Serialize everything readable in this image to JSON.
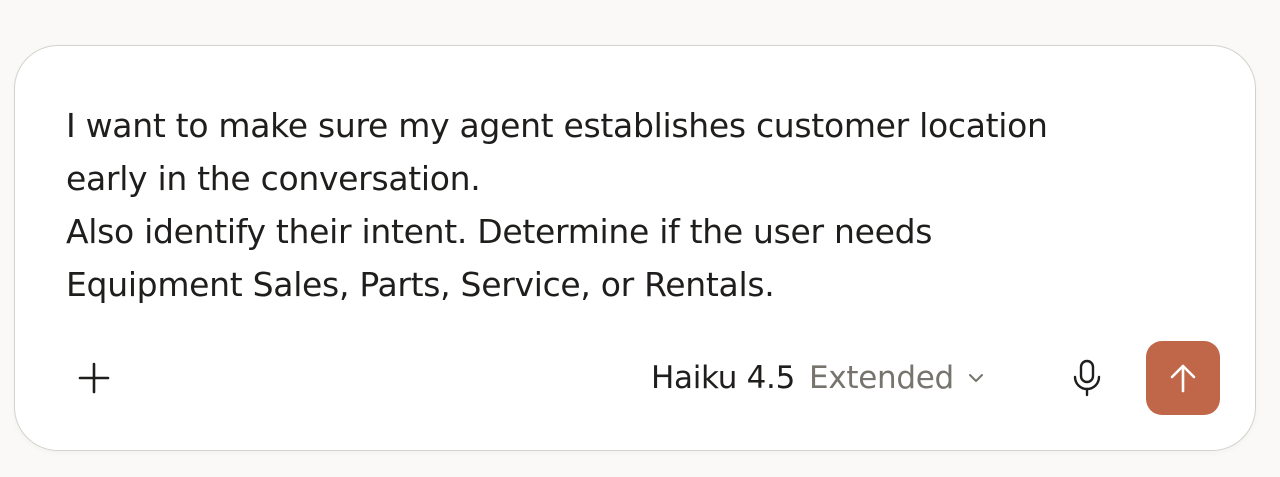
{
  "composer": {
    "message_lines": [
      "I want to make sure my agent establishes customer location",
      "early in the conversation.",
      "Also identify their intent. Determine if the user needs",
      "Equipment Sales, Parts, Service, or Rentals."
    ]
  },
  "toolbar": {
    "add_icon": "plus-icon",
    "model_name": "Haiku 4.5",
    "model_mode": "Extended",
    "dropdown_icon": "chevron-down-icon",
    "mic_icon": "microphone-icon",
    "send_icon": "arrow-up-icon"
  },
  "colors": {
    "send_button": "#c0674a",
    "text_primary": "#1f1e1c",
    "text_secondary": "#77746e",
    "border": "#d4d2cc",
    "background": "#faf9f7"
  }
}
